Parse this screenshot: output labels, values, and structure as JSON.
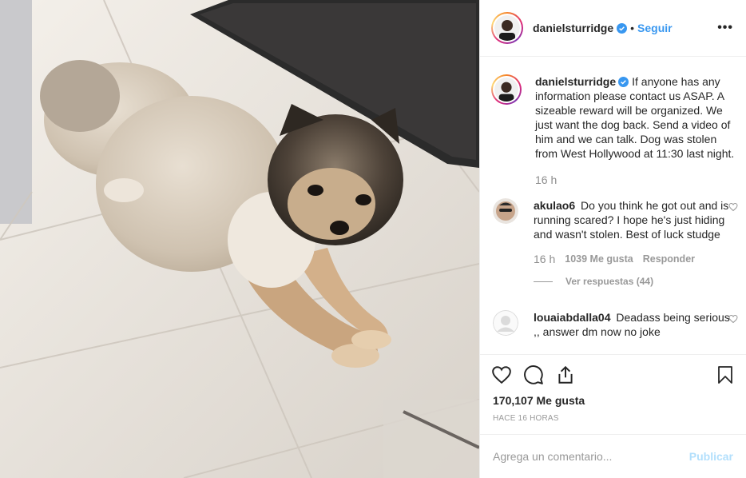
{
  "post": {
    "username": "danielsturridge",
    "follow_label": "Seguir",
    "dot": "•",
    "more_label": "•••",
    "caption": "If anyone has any information please contact us ASAP. A sizeable reward will be organized. We just want the dog back. Send a video of him and we can talk. Dog was stolen from West Hollywood at 11:30 last night.",
    "caption_time": "16 h"
  },
  "comments": [
    {
      "username": "akulao6",
      "text": "Do you think he got out and is running scared? I hope he's just hiding and wasn't stolen. Best of luck studge",
      "time": "16 h",
      "likes": "1039 Me gusta",
      "reply_label": "Responder",
      "view_replies": "Ver respuestas (44)"
    },
    {
      "username": "louaiabdalla04",
      "text": "Deadass being serious ,, answer dm now no joke"
    }
  ],
  "stats": {
    "likes": "170,107 Me gusta",
    "posted_ago": "HACE 16 HORAS"
  },
  "composer": {
    "placeholder": "Agrega un comentario...",
    "publish_label": "Publicar"
  },
  "colors": {
    "link": "#3897f0",
    "muted": "#999999",
    "publish_disabled": "#b2dffc"
  },
  "icons": [
    "heart-icon",
    "comment-icon",
    "share-icon",
    "bookmark-icon",
    "verified-badge-icon",
    "more-icon"
  ]
}
